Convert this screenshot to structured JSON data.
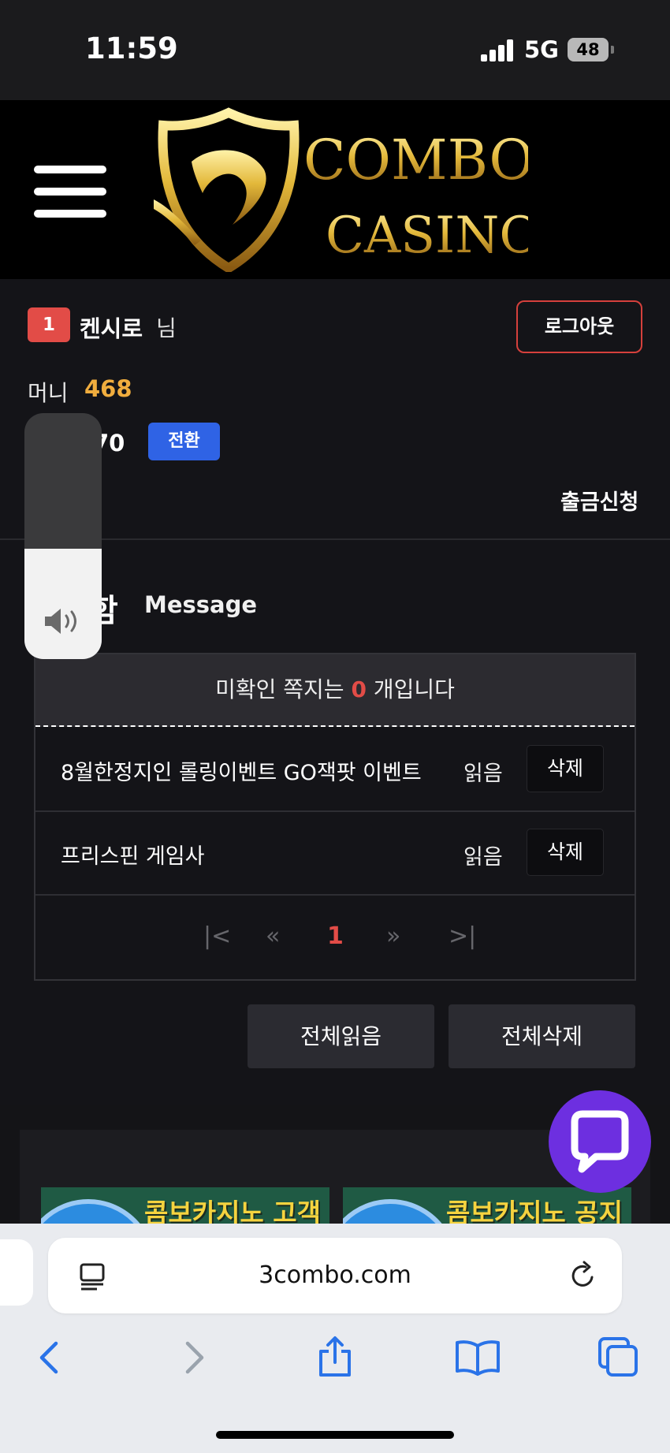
{
  "status_bar": {
    "time": "11:59",
    "network": "5G",
    "battery": "48"
  },
  "header": {
    "menu_icon": "hamburger-icon",
    "logo_line1": "COMBO",
    "logo_line2": "CASINO"
  },
  "user": {
    "grade": "1",
    "name": "켄시로",
    "honorific": "님",
    "logout_label": "로그아웃",
    "money_label": "머니",
    "money_value": "468",
    "point_value": "70",
    "convert_label": "전환",
    "deposit_label": "!",
    "withdraw_label": "출금신청"
  },
  "messages": {
    "title_ko": "함",
    "title_en": "Message",
    "unread_prefix": "미확인 쪽지는 ",
    "unread_count": "0",
    "unread_suffix": " 개입니다",
    "items": [
      {
        "subject": "8월한정지인 롤링이벤트 GO잭팟 이벤트",
        "status": "읽음",
        "delete_label": "삭제"
      },
      {
        "subject": "프리스핀 게임사",
        "status": "읽음",
        "delete_label": "삭제"
      }
    ],
    "pagination": {
      "first": "|<",
      "prev": "«",
      "current": "1",
      "next": "»",
      "last": ">|"
    },
    "read_all_label": "전체읽음",
    "delete_all_label": "전체삭제"
  },
  "promos": [
    {
      "text": "콤보카지노 고객센터 연결"
    },
    {
      "text": "콤보카지노 공지 채널방"
    }
  ],
  "chat_icon": "chat-bubble-icon",
  "volume": {
    "level": 0.45,
    "icon": "speaker-icon"
  },
  "browser": {
    "url": "3combo.com",
    "reader_icon": "reader-icon",
    "reload_icon": "reload-icon",
    "toolbar": [
      "back-icon",
      "forward-icon",
      "share-icon",
      "bookmarks-icon",
      "tabs-icon"
    ]
  }
}
